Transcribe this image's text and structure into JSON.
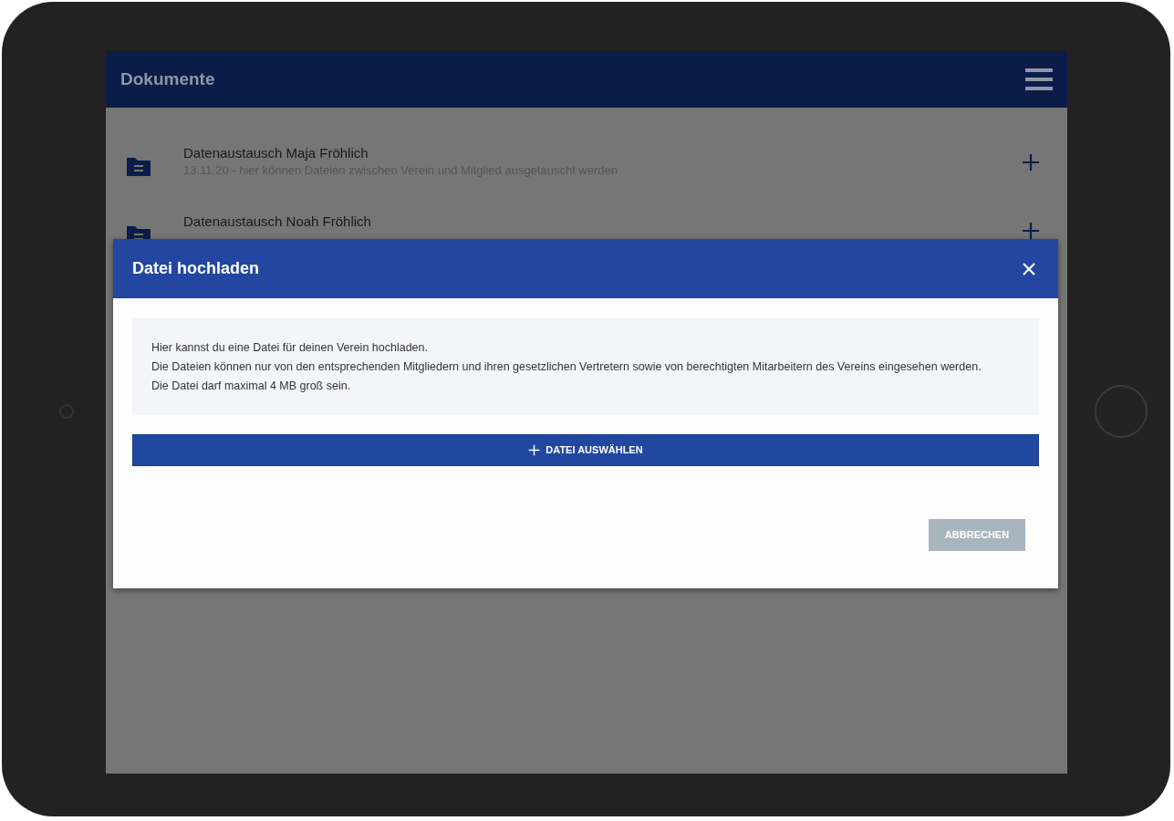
{
  "app_bar": {
    "title": "Dokumente"
  },
  "documents": [
    {
      "title": "Datenaustausch Maja Fröhlich",
      "subtitle": "13.11.20 - hier können Dateien zwischen Verein und Mitglied ausgetauscht werden"
    },
    {
      "title": "Datenaustausch Noah Fröhlich"
    }
  ],
  "dialog": {
    "title": "Datei hochladen",
    "info_lines": [
      "Hier kannst du eine Datei für deinen Verein hochladen.",
      "Die Dateien können nur von den entsprechenden Mitgliedern und ihren gesetzlichen Vertretern sowie von berechtigten Mitarbeitern des Vereins eingesehen werden.",
      "Die Datei darf maximal 4 MB groß sein."
    ],
    "select_button": "DATEI AUSWÄHLEN",
    "cancel_button": {
      "label": "ABBRECHEN",
      "disabled": true
    }
  }
}
